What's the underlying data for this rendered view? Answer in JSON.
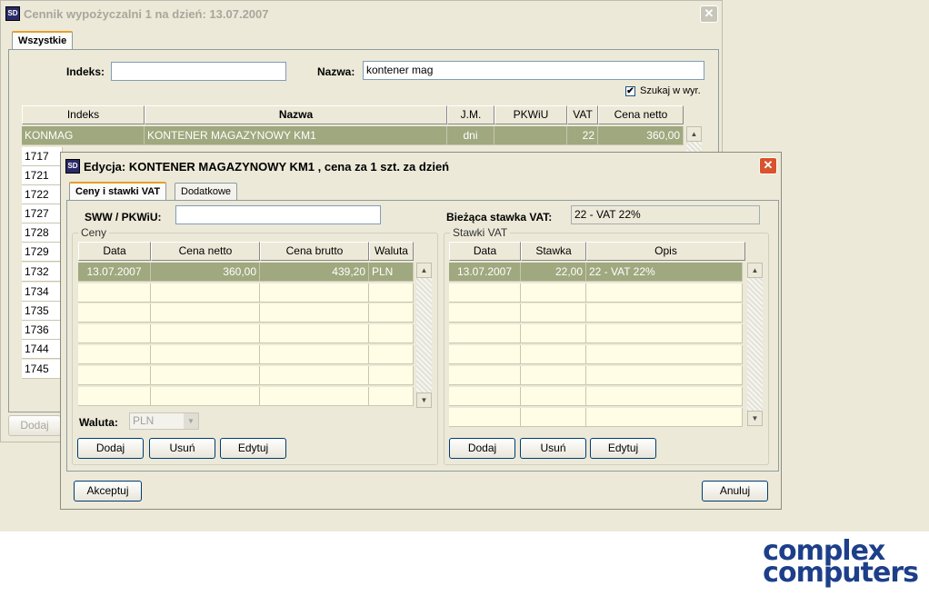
{
  "back_window": {
    "title": "Cennik wypożyczalni 1 na dzień: 13.07.2007",
    "tab": "Wszystkie",
    "indeks_label": "Indeks:",
    "indeks_value": "",
    "nazwa_label": "Nazwa:",
    "nazwa_value": "kontener mag",
    "search_in_expr_label": "Szukaj w wyr.",
    "search_in_expr_checked": true,
    "columns": [
      "Indeks",
      "Nazwa",
      "J.M.",
      "PKWiU",
      "VAT",
      "Cena netto"
    ],
    "selected_row": {
      "indeks": "KONMAG",
      "nazwa": "KONTENER MAGAZYNOWY KM1",
      "jm": "dni",
      "pkwiu": "",
      "vat": "22",
      "cena": "360,00"
    },
    "rows": [
      "1717",
      "1721",
      "1722",
      "1727",
      "1728",
      "1729",
      "1732",
      "1734",
      "1735",
      "1736",
      "1744",
      "1745"
    ],
    "add_button": "Dodaj"
  },
  "front_window": {
    "title": "Edycja: KONTENER MAGAZYNOWY KM1 ,  cena za 1 szt. za dzień",
    "tabs": [
      "Ceny i stawki VAT",
      "Dodatkowe"
    ],
    "sww_label": "SWW / PKWiU:",
    "sww_value": "",
    "current_vat_label": "Bieżąca stawka VAT:",
    "current_vat_value": "22 - VAT 22%",
    "prices": {
      "group_title": "Ceny",
      "columns": [
        "Data",
        "Cena netto",
        "Cena brutto",
        "Waluta"
      ],
      "rows": [
        {
          "data": "13.07.2007",
          "netto": "360,00",
          "brutto": "439,20",
          "waluta": "PLN"
        }
      ],
      "currency_label": "Waluta:",
      "currency_value": "PLN",
      "buttons": {
        "add": "Dodaj",
        "delete": "Usuń",
        "edit": "Edytuj"
      }
    },
    "vat_rates": {
      "group_title": "Stawki VAT",
      "columns": [
        "Data",
        "Stawka",
        "Opis"
      ],
      "rows": [
        {
          "data": "13.07.2007",
          "stawka": "22,00",
          "opis": "22 - VAT 22%"
        }
      ],
      "buttons": {
        "add": "Dodaj",
        "delete": "Usuń",
        "edit": "Edytuj"
      }
    },
    "accept_button": "Akceptuj",
    "cancel_button": "Anuluj"
  },
  "brand": {
    "line1": "complex",
    "line2": "computers",
    "color": "#1d3f8a"
  }
}
